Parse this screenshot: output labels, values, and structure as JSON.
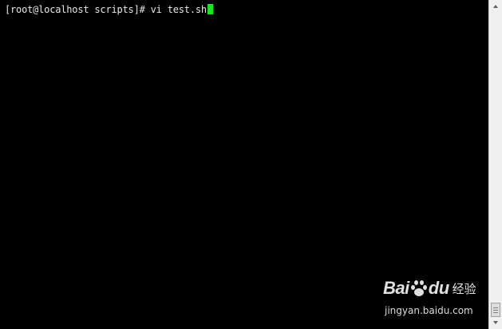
{
  "terminal": {
    "prompt": "[root@localhost scripts]#",
    "command": " vi test.sh",
    "cursor_color": "#19e619"
  },
  "watermark": {
    "brand_left": "Bai",
    "brand_right": "du",
    "brand_cn": "经验",
    "url": "jingyan.baidu.com",
    "logo_icon": "paw-icon"
  },
  "scrollbar": {
    "up_icon": "arrow-up-icon",
    "down_icon": "arrow-down-icon",
    "thumb_icon": "grip-icon"
  },
  "colors": {
    "background": "#000000",
    "text": "#e6e6e6",
    "scrollbar": "#f0f0f0"
  }
}
